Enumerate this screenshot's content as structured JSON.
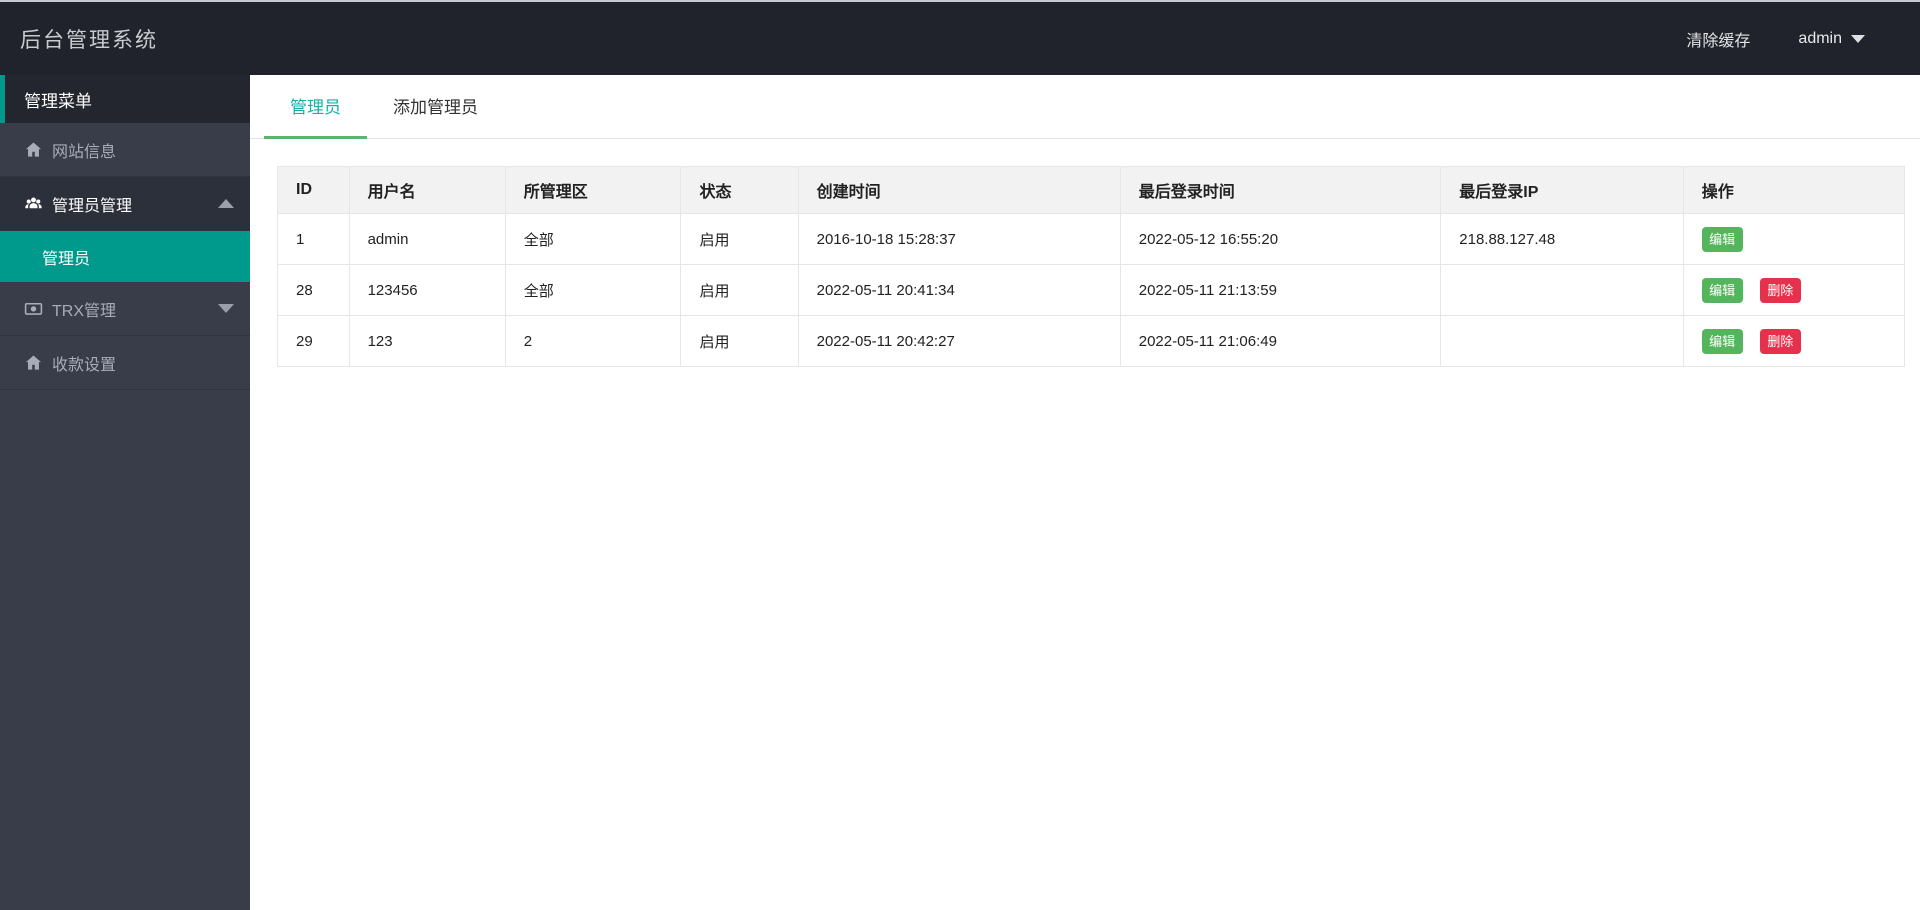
{
  "header": {
    "logo": "后台管理系统",
    "clear_cache": "清除缓存",
    "user": "admin"
  },
  "sidebar": {
    "menu_title": "管理菜单",
    "items": [
      {
        "label": "网站信息",
        "icon": "home-icon"
      },
      {
        "label": "管理员管理",
        "icon": "users-icon",
        "state": "expanded"
      },
      {
        "label": "管理员",
        "type": "submenu",
        "state": "active"
      },
      {
        "label": "TRX管理",
        "icon": "money-icon",
        "state": "collapsed"
      },
      {
        "label": "收款设置",
        "icon": "home-icon"
      }
    ]
  },
  "tabs": [
    {
      "label": "管理员",
      "active": true
    },
    {
      "label": "添加管理员",
      "active": false
    }
  ],
  "table": {
    "columns": [
      "ID",
      "用户名",
      "所管理区",
      "状态",
      "创建时间",
      "最后登录时间",
      "最后登录IP",
      "操作"
    ],
    "rows": [
      {
        "cells": [
          "1",
          "admin",
          "全部",
          "启用",
          "2016-10-18 15:28:37",
          "2022-05-12 16:55:20",
          "218.88.127.48"
        ]
      },
      {
        "cells": [
          "28",
          "123456",
          "全部",
          "启用",
          "2022-05-11 20:41:34",
          "2022-05-11 21:13:59",
          ""
        ]
      },
      {
        "cells": [
          "29",
          "123",
          "2",
          "启用",
          "2022-05-11 20:42:27",
          "2022-05-11 21:06:49",
          ""
        ]
      }
    ],
    "action_labels": {
      "edit": "编辑",
      "delete": "删除"
    }
  },
  "colors": {
    "accent_teal": "#009a8c",
    "tab_underline_green": "#5bb56c",
    "tab_active_text": "#15b2a3",
    "button_green": "#55b55c",
    "button_red": "#e5314b",
    "topbar_bg": "#20232b",
    "sidebar_bg": "#393d49"
  }
}
